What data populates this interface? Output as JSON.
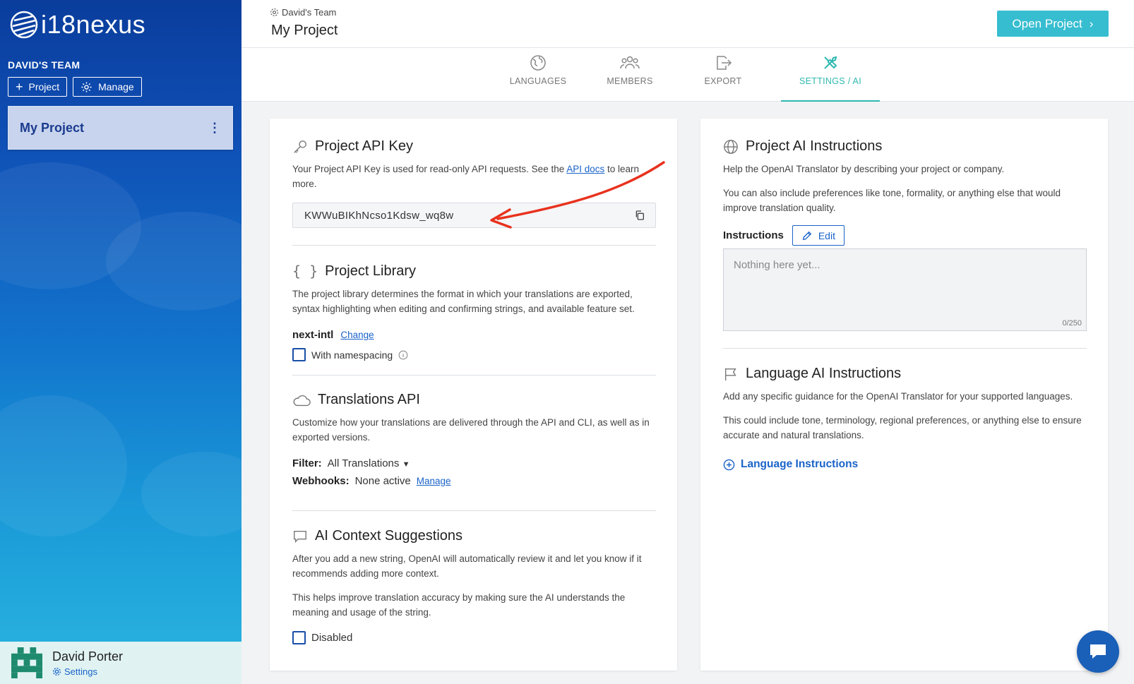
{
  "sidebar": {
    "logo_text": "i18nexus",
    "team_label": "DAVID'S TEAM",
    "project_button": "Project",
    "manage_button": "Manage",
    "active_project": "My Project",
    "user": {
      "name": "David Porter",
      "settings_label": "Settings"
    }
  },
  "header": {
    "team_name": "David's Team",
    "project_title": "My Project",
    "open_button": "Open Project"
  },
  "tabs": [
    {
      "label": "LANGUAGES",
      "icon": "globe-icon",
      "active": false
    },
    {
      "label": "MEMBERS",
      "icon": "members-icon",
      "active": false
    },
    {
      "label": "EXPORT",
      "icon": "export-icon",
      "active": false
    },
    {
      "label": "SETTINGS / AI",
      "icon": "tools-icon",
      "active": true
    }
  ],
  "left": {
    "api_key": {
      "title": "Project API Key",
      "desc_before": "Your Project API Key is used for read-only API requests. See the ",
      "desc_link": "API docs",
      "desc_after": " to learn more.",
      "value": "KWWuBIKhNcso1Kdsw_wq8w"
    },
    "library": {
      "title": "Project Library",
      "desc": "The project library determines the format in which your translations are exported, syntax highlighting when editing and confirming strings, and available feature set.",
      "name": "next-intl",
      "change_link": "Change",
      "namespacing_label": "With namespacing"
    },
    "translations_api": {
      "title": "Translations API",
      "desc": "Customize how your translations are delivered through the API and CLI, as well as in exported versions.",
      "filter_label": "Filter:",
      "filter_value": "All Translations",
      "webhooks_label": "Webhooks:",
      "webhooks_value": "None active",
      "manage_link": "Manage"
    },
    "ai_context": {
      "title": "AI Context Suggestions",
      "desc1": "After you add a new string, OpenAI will automatically review it and let you know if it recommends adding more context.",
      "desc2": "This helps improve translation accuracy by making sure the AI understands the meaning and usage of the string.",
      "disabled_label": "Disabled"
    }
  },
  "right": {
    "project_ai": {
      "title": "Project AI Instructions",
      "desc1": "Help the OpenAI Translator by describing your project or company.",
      "desc2": "You can also include preferences like tone, formality, or anything else that would improve translation quality.",
      "instructions_label": "Instructions",
      "edit_button": "Edit",
      "placeholder": "Nothing here yet...",
      "counter": "0/250"
    },
    "language_ai": {
      "title": "Language AI Instructions",
      "desc1": "Add any specific guidance for the OpenAI Translator for your supported languages.",
      "desc2": "This could include tone, terminology, regional preferences, or anything else to ensure accurate and natural translations.",
      "link": "Language Instructions"
    }
  },
  "colors": {
    "accent": "#2fb8b0",
    "primary_button": "#37bdd0",
    "link": "#1a63c9",
    "annotation_arrow": "#e8321e"
  }
}
